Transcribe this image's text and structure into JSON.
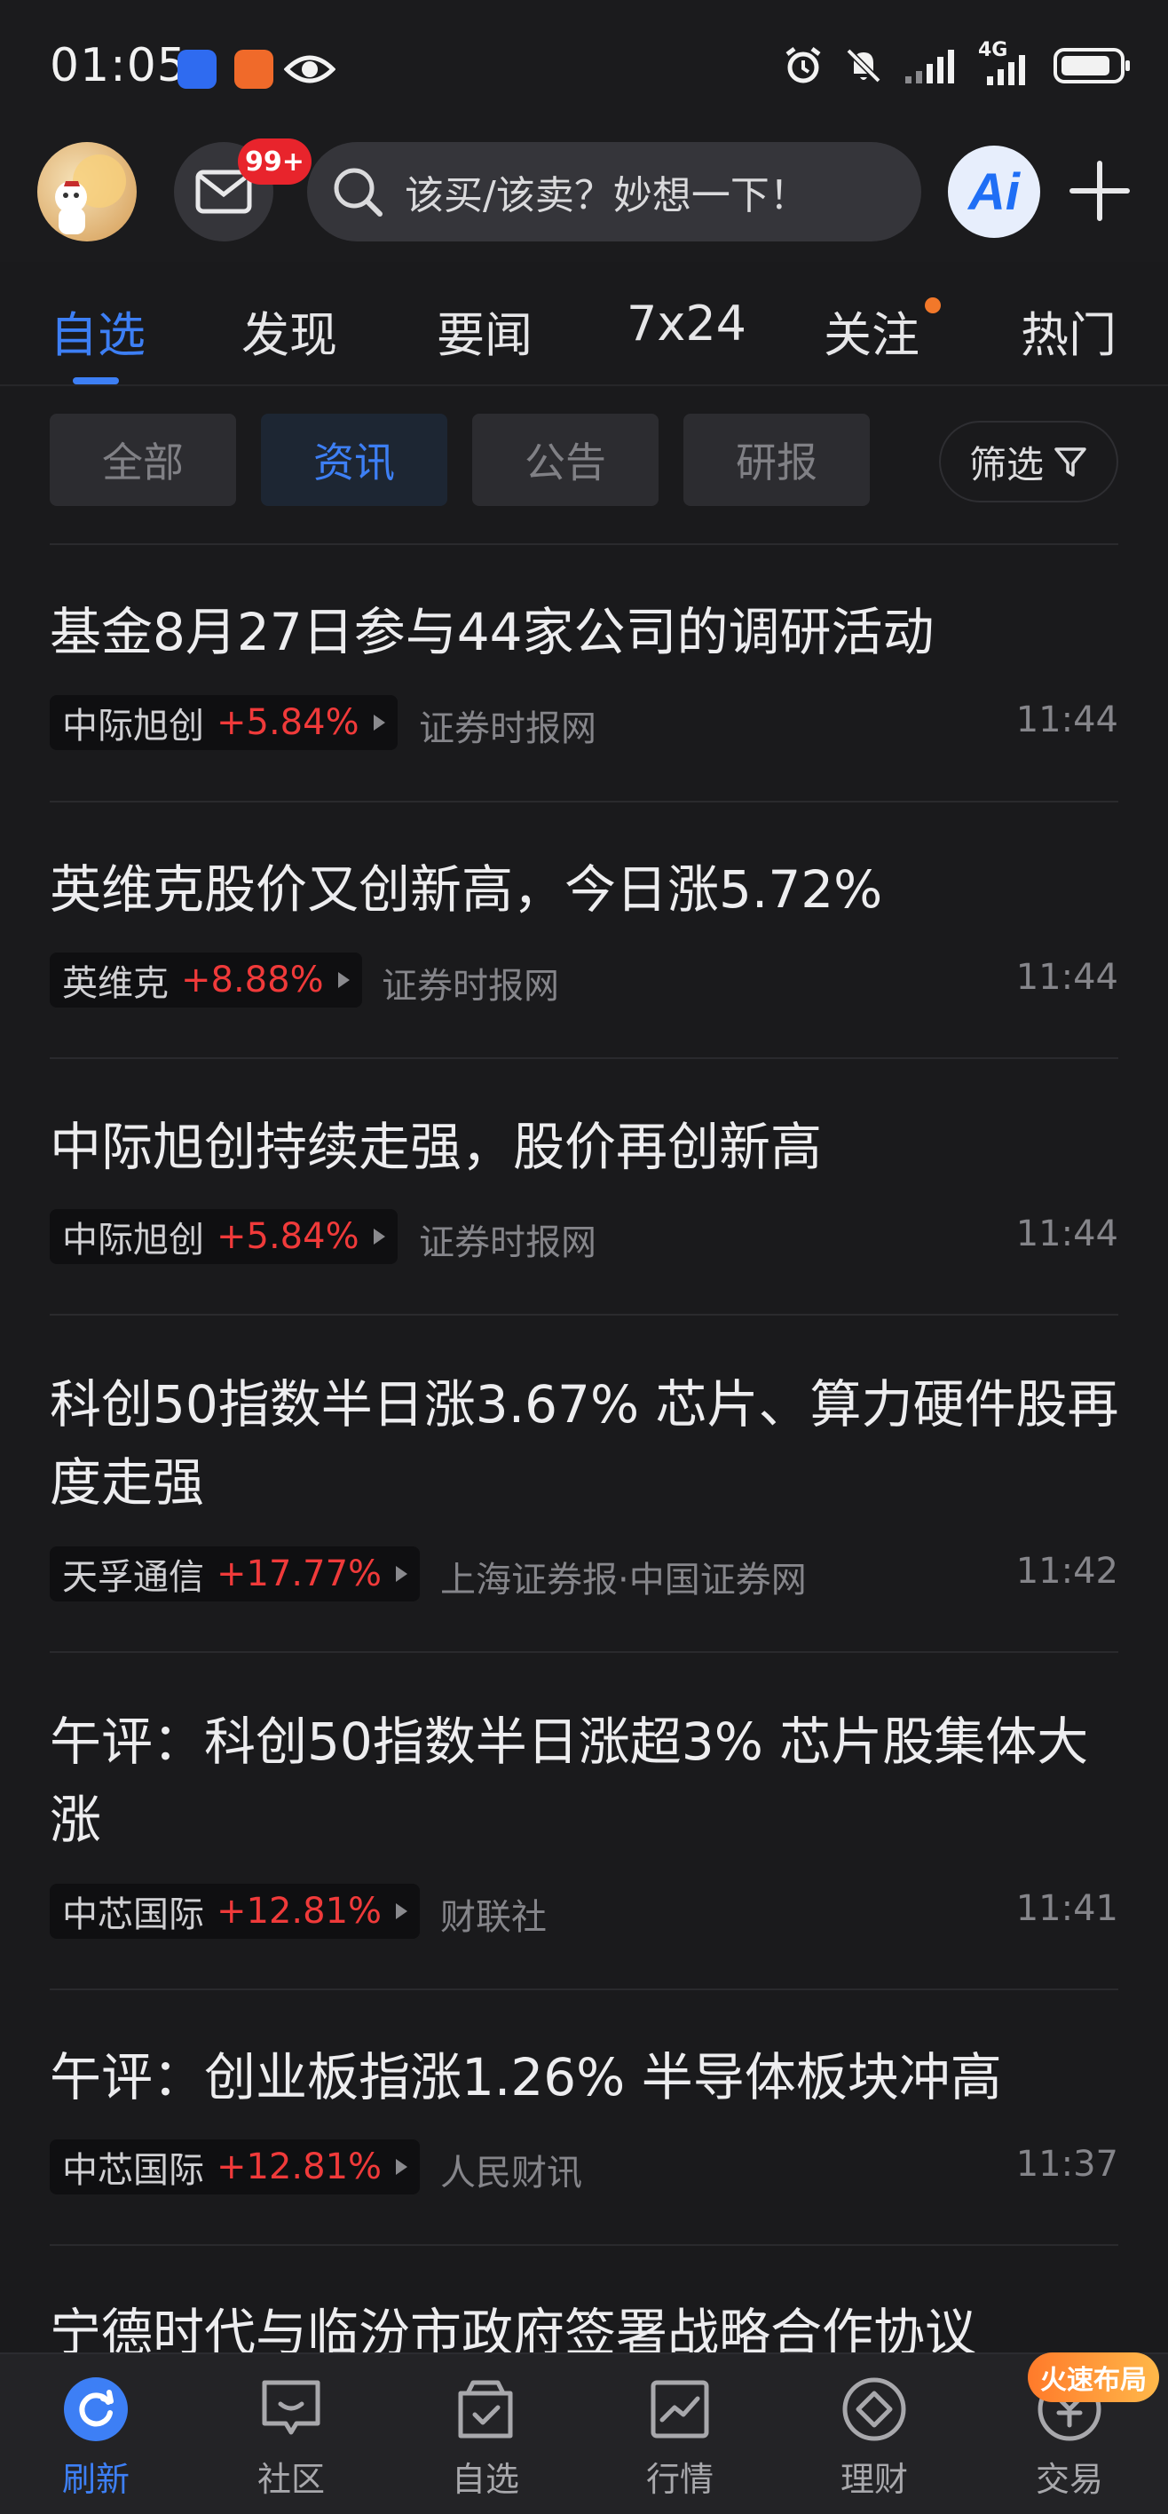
{
  "status_bar": {
    "time": "01:05",
    "network": "4G"
  },
  "header": {
    "mail_badge": "99+",
    "search_placeholder": "该买/该卖？妙想一下！",
    "ai_label": "Ai"
  },
  "tabs": [
    {
      "label": "自选",
      "active": true
    },
    {
      "label": "发现",
      "active": false
    },
    {
      "label": "要闻",
      "active": false
    },
    {
      "label": "7x24",
      "active": false
    },
    {
      "label": "关注",
      "active": false,
      "dot": true
    },
    {
      "label": "热门",
      "active": false
    }
  ],
  "filters": {
    "chips": [
      {
        "label": "全部",
        "active": false
      },
      {
        "label": "资讯",
        "active": true
      },
      {
        "label": "公告",
        "active": false
      },
      {
        "label": "研报",
        "active": false
      }
    ],
    "filter_button": "筛选"
  },
  "news": [
    {
      "title": "基金8月27日参与44家公司的调研活动",
      "stock": "中际旭创",
      "change": "+5.84%",
      "source": "证券时报网",
      "time": "11:44"
    },
    {
      "title": "英维克股价又创新高，今日涨5.72%",
      "stock": "英维克",
      "change": "+8.88%",
      "source": "证券时报网",
      "time": "11:44"
    },
    {
      "title": "中际旭创持续走强，股价再创新高",
      "stock": "中际旭创",
      "change": "+5.84%",
      "source": "证券时报网",
      "time": "11:44"
    },
    {
      "title": "科创50指数半日涨3.67% 芯片、算力硬件股再度走强",
      "stock": "天孚通信",
      "change": "+17.77%",
      "source": "上海证券报·中国证券网",
      "time": "11:42"
    },
    {
      "title": "午评：科创50指数半日涨超3% 芯片股集体大涨",
      "stock": "中芯国际",
      "change": "+12.81%",
      "source": "财联社",
      "time": "11:41"
    },
    {
      "title": "午评：创业板指涨1.26% 半导体板块冲高",
      "stock": "中芯国际",
      "change": "+12.81%",
      "source": "人民财讯",
      "time": "11:37"
    },
    {
      "title": "宁德时代与临汾市政府签署战略合作协议",
      "stock": "",
      "change": "",
      "source": "",
      "time": ""
    }
  ],
  "bottom_nav": {
    "items": [
      {
        "label": "刷新",
        "icon": "refresh-icon",
        "active": true
      },
      {
        "label": "社区",
        "icon": "community-icon",
        "active": false
      },
      {
        "label": "自选",
        "icon": "watchlist-icon",
        "active": false
      },
      {
        "label": "行情",
        "icon": "market-icon",
        "active": false
      },
      {
        "label": "理财",
        "icon": "finance-icon",
        "active": false
      },
      {
        "label": "交易",
        "icon": "trade-icon",
        "active": false
      }
    ],
    "promo_badge": "火速布局"
  },
  "colors": {
    "accent": "#3d7ff5",
    "rise": "#f03a3a",
    "background": "#1a1a1c"
  }
}
